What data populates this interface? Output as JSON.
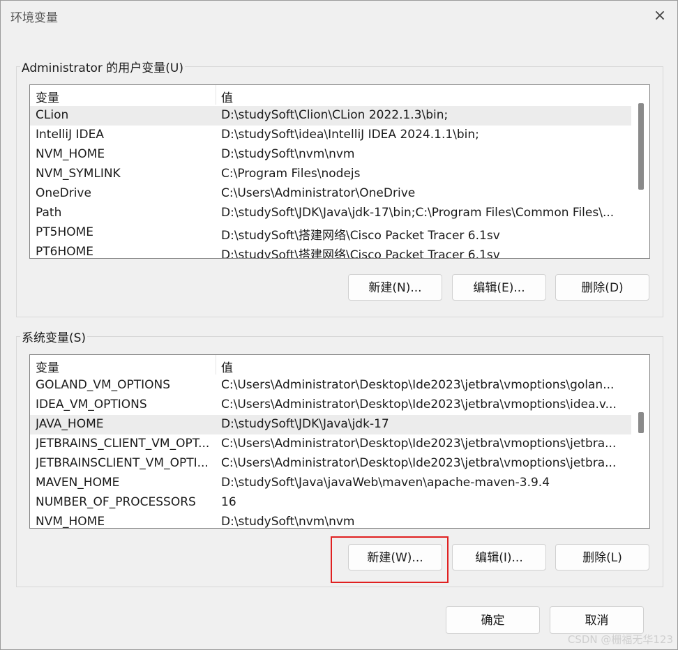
{
  "window": {
    "title": "环境变量",
    "close_icon": "×"
  },
  "user_vars": {
    "label": "Administrator 的用户变量(U)",
    "headers": {
      "name": "变量",
      "value": "值"
    },
    "rows": [
      {
        "name": "CLion",
        "value": "D:\\studySoft\\Clion\\CLion 2022.1.3\\bin;",
        "selected": true
      },
      {
        "name": "IntelliJ IDEA",
        "value": "D:\\studySoft\\idea\\IntelliJ IDEA 2024.1.1\\bin;"
      },
      {
        "name": "NVM_HOME",
        "value": "D:\\studySoft\\nvm\\nvm"
      },
      {
        "name": "NVM_SYMLINK",
        "value": "C:\\Program Files\\nodejs"
      },
      {
        "name": "OneDrive",
        "value": "C:\\Users\\Administrator\\OneDrive"
      },
      {
        "name": "Path",
        "value": "D:\\studySoft\\JDK\\Java\\jdk-17\\bin;C:\\Program Files\\Common Files\\..."
      },
      {
        "name": "PT5HOME",
        "value": "D:\\studySoft\\搭建网络\\Cisco Packet Tracer 6.1sv"
      },
      {
        "name": "PT6HOME",
        "value": "D:\\studySoft\\搭建网络\\Cisco Packet Tracer 6.1sv"
      }
    ],
    "buttons": {
      "new": "新建(N)...",
      "edit": "编辑(E)...",
      "delete": "删除(D)"
    }
  },
  "system_vars": {
    "label": "系统变量(S)",
    "headers": {
      "name": "变量",
      "value": "值"
    },
    "rows": [
      {
        "name": "GOLAND_VM_OPTIONS",
        "value": "C:\\Users\\Administrator\\Desktop\\Ide2023\\jetbra\\vmoptions\\golan..."
      },
      {
        "name": "IDEA_VM_OPTIONS",
        "value": "C:\\Users\\Administrator\\Desktop\\Ide2023\\jetbra\\vmoptions\\idea.v..."
      },
      {
        "name": "JAVA_HOME",
        "value": "D:\\studySoft\\JDK\\Java\\jdk-17",
        "selected": true
      },
      {
        "name": "JETBRAINS_CLIENT_VM_OPT...",
        "value": "C:\\Users\\Administrator\\Desktop\\Ide2023\\jetbra\\vmoptions\\jetbra..."
      },
      {
        "name": "JETBRAINSCLIENT_VM_OPTI...",
        "value": "C:\\Users\\Administrator\\Desktop\\Ide2023\\jetbra\\vmoptions\\jetbra..."
      },
      {
        "name": "MAVEN_HOME",
        "value": "D:\\studySoft\\Java\\javaWeb\\maven\\apache-maven-3.9.4"
      },
      {
        "name": "NUMBER_OF_PROCESSORS",
        "value": "16"
      },
      {
        "name": "NVM_HOME",
        "value": "D:\\studySoft\\nvm\\nvm"
      }
    ],
    "buttons": {
      "new": "新建(W)...",
      "edit": "编辑(I)...",
      "delete": "删除(L)"
    }
  },
  "footer": {
    "ok": "确定",
    "cancel": "取消"
  },
  "watermark": "CSDN @栅福无华123",
  "colors": {
    "highlight": "#e02020",
    "selection": "#ececec"
  }
}
